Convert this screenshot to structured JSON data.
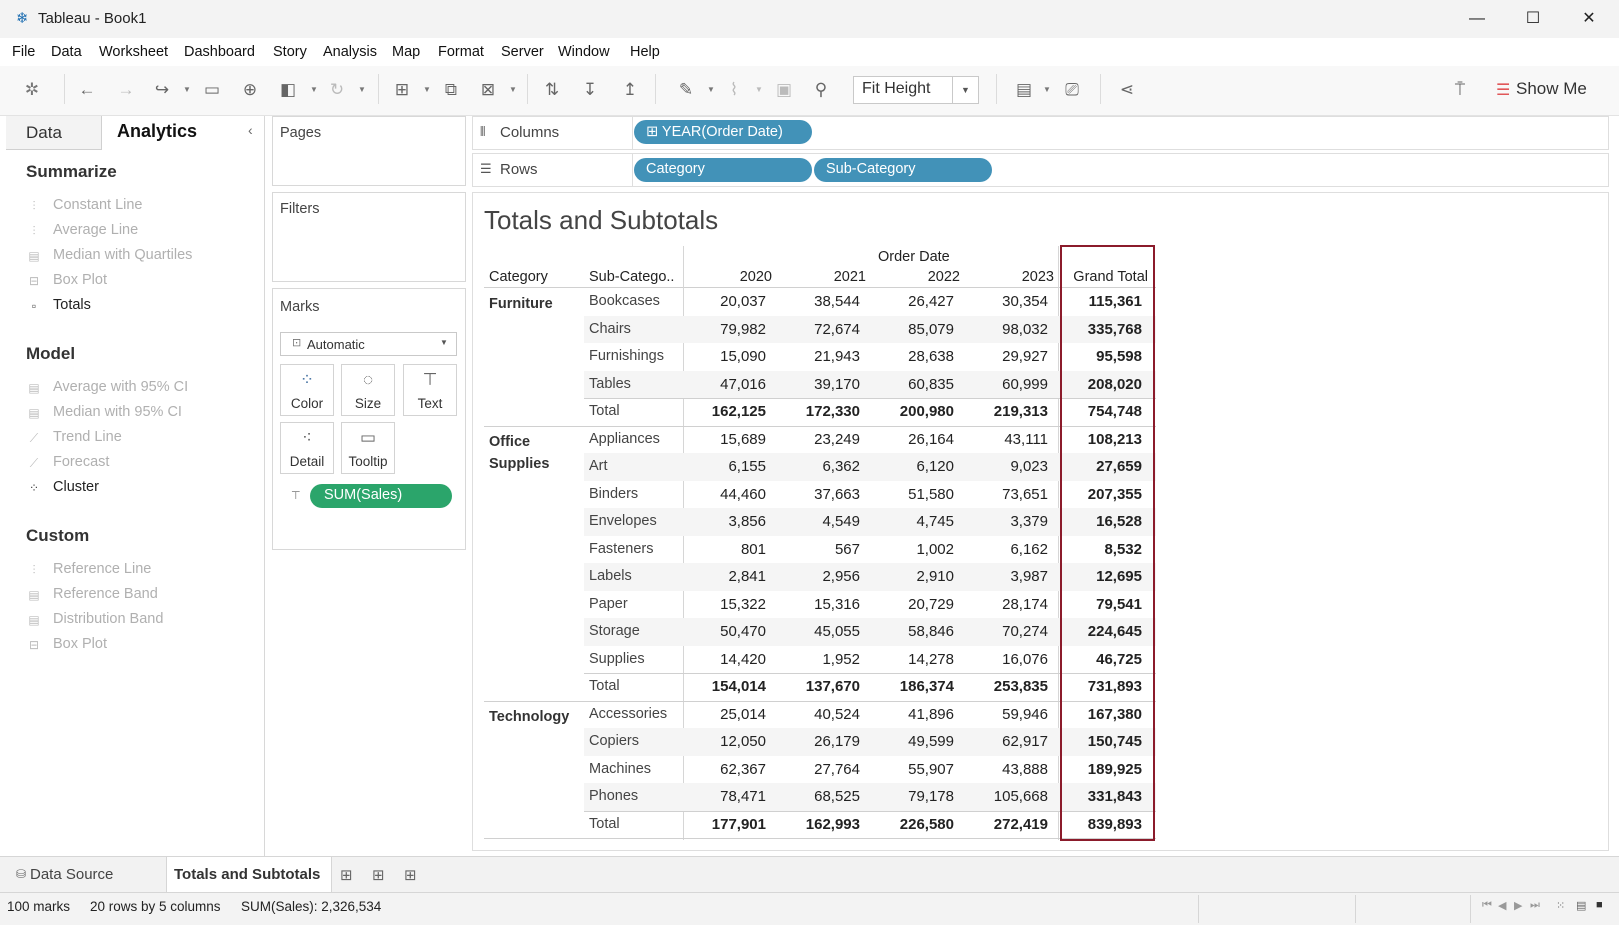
{
  "window": {
    "title": "Tableau - Book1",
    "minimize": "—",
    "maximize": "☐",
    "close": "✕"
  },
  "menu": [
    "File",
    "Data",
    "Worksheet",
    "Dashboard",
    "Story",
    "Analysis",
    "Map",
    "Format",
    "Server",
    "Window",
    "Help"
  ],
  "toolbar": {
    "fit_label": "Fit Height",
    "show_me_label": "Show Me"
  },
  "left_pane": {
    "tabs": [
      "Data",
      "Analytics"
    ],
    "sections": [
      {
        "title": "Summarize",
        "items": [
          {
            "label": "Constant Line",
            "icon": "constant-line-icon",
            "enabled": false
          },
          {
            "label": "Average Line",
            "icon": "average-line-icon",
            "enabled": false
          },
          {
            "label": "Median with Quartiles",
            "icon": "median-quartiles-icon",
            "enabled": false
          },
          {
            "label": "Box Plot",
            "icon": "box-plot-icon",
            "enabled": false
          },
          {
            "label": "Totals",
            "icon": "totals-icon",
            "enabled": true
          }
        ]
      },
      {
        "title": "Model",
        "items": [
          {
            "label": "Average with 95% CI",
            "icon": "average-ci-icon",
            "enabled": false
          },
          {
            "label": "Median with 95% CI",
            "icon": "median-ci-icon",
            "enabled": false
          },
          {
            "label": "Trend Line",
            "icon": "trend-line-icon",
            "enabled": false
          },
          {
            "label": "Forecast",
            "icon": "forecast-icon",
            "enabled": false
          },
          {
            "label": "Cluster",
            "icon": "cluster-icon",
            "enabled": true
          }
        ]
      },
      {
        "title": "Custom",
        "items": [
          {
            "label": "Reference Line",
            "icon": "reference-line-icon",
            "enabled": false
          },
          {
            "label": "Reference Band",
            "icon": "reference-band-icon",
            "enabled": false
          },
          {
            "label": "Distribution Band",
            "icon": "distribution-band-icon",
            "enabled": false
          },
          {
            "label": "Box Plot",
            "icon": "box-plot-icon",
            "enabled": false
          }
        ]
      }
    ]
  },
  "cards": {
    "pages": "Pages",
    "filters": "Filters",
    "marks": "Marks",
    "mark_type": "Automatic",
    "mark_buttons": [
      "Color",
      "Size",
      "Text",
      "Detail",
      "Tooltip"
    ],
    "mark_pill": "SUM(Sales)"
  },
  "shelves": {
    "columns_label": "Columns",
    "rows_label": "Rows",
    "columns_pills": [
      "YEAR(Order Date)"
    ],
    "rows_pills": [
      "Category",
      "Sub-Category"
    ]
  },
  "viz": {
    "title": "Totals and Subtotals",
    "header_group": "Order Date",
    "col_headers": [
      "Category",
      "Sub-Catego..",
      "2020",
      "2021",
      "2022",
      "2023",
      "Grand Total"
    ],
    "groups": [
      {
        "category": "Furniture",
        "rows": [
          [
            "Bookcases",
            "20,037",
            "38,544",
            "26,427",
            "30,354",
            "115,361"
          ],
          [
            "Chairs",
            "79,982",
            "72,674",
            "85,079",
            "98,032",
            "335,768"
          ],
          [
            "Furnishings",
            "15,090",
            "21,943",
            "28,638",
            "29,927",
            "95,598"
          ],
          [
            "Tables",
            "47,016",
            "39,170",
            "60,835",
            "60,999",
            "208,020"
          ],
          [
            "Total",
            "162,125",
            "172,330",
            "200,980",
            "219,313",
            "754,748"
          ]
        ]
      },
      {
        "category": "Office Supplies",
        "rows": [
          [
            "Appliances",
            "15,689",
            "23,249",
            "26,164",
            "43,111",
            "108,213"
          ],
          [
            "Art",
            "6,155",
            "6,362",
            "6,120",
            "9,023",
            "27,659"
          ],
          [
            "Binders",
            "44,460",
            "37,663",
            "51,580",
            "73,651",
            "207,355"
          ],
          [
            "Envelopes",
            "3,856",
            "4,549",
            "4,745",
            "3,379",
            "16,528"
          ],
          [
            "Fasteners",
            "801",
            "567",
            "1,002",
            "6,162",
            "8,532"
          ],
          [
            "Labels",
            "2,841",
            "2,956",
            "2,910",
            "3,987",
            "12,695"
          ],
          [
            "Paper",
            "15,322",
            "15,316",
            "20,729",
            "28,174",
            "79,541"
          ],
          [
            "Storage",
            "50,470",
            "45,055",
            "58,846",
            "70,274",
            "224,645"
          ],
          [
            "Supplies",
            "14,420",
            "1,952",
            "14,278",
            "16,076",
            "46,725"
          ],
          [
            "Total",
            "154,014",
            "137,670",
            "186,374",
            "253,835",
            "731,893"
          ]
        ]
      },
      {
        "category": "Technology",
        "rows": [
          [
            "Accessories",
            "25,014",
            "40,524",
            "41,896",
            "59,946",
            "167,380"
          ],
          [
            "Copiers",
            "12,050",
            "26,179",
            "49,599",
            "62,917",
            "150,745"
          ],
          [
            "Machines",
            "62,367",
            "27,764",
            "55,907",
            "43,888",
            "189,925"
          ],
          [
            "Phones",
            "78,471",
            "68,525",
            "79,178",
            "105,668",
            "331,843"
          ],
          [
            "Total",
            "177,901",
            "162,993",
            "226,580",
            "272,419",
            "839,893"
          ]
        ]
      }
    ]
  },
  "tabs": {
    "data_source": "Data Source",
    "sheet": "Totals and Subtotals"
  },
  "status": {
    "marks": "100 marks",
    "dims": "20 rows by 5 columns",
    "sum": "SUM(Sales): 2,326,534"
  },
  "colors": {
    "pill_blue": "#4292b8",
    "pill_green": "#2ba56b",
    "highlight": "#8b1b2b"
  }
}
